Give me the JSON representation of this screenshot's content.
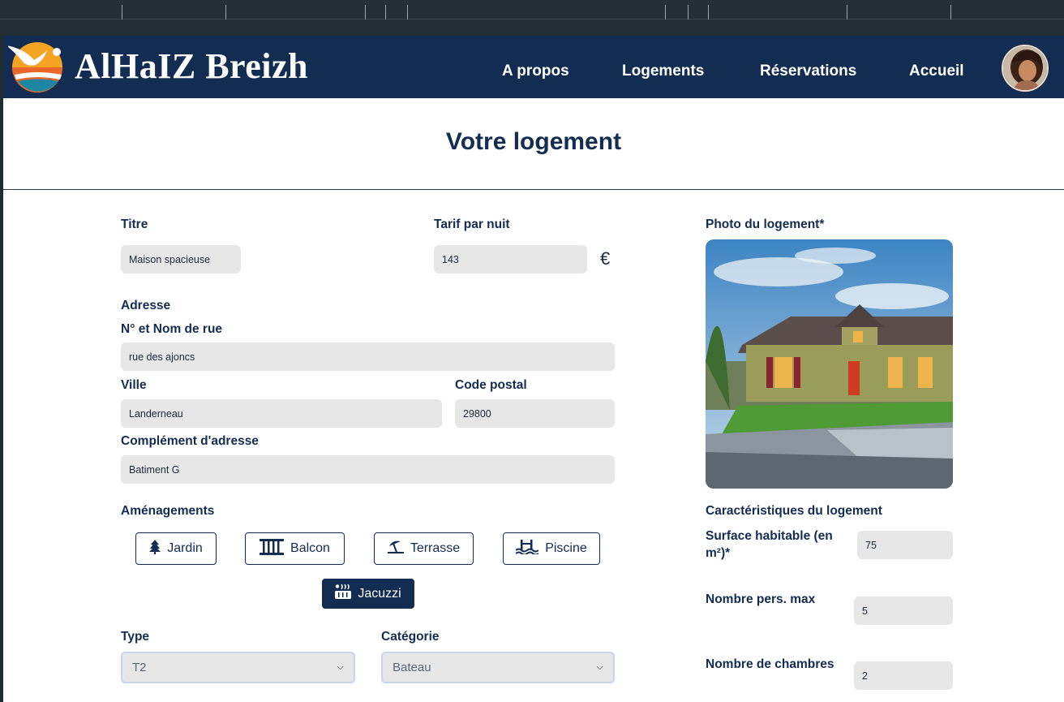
{
  "brand": {
    "name": "AlHaIZ Breizh"
  },
  "nav": {
    "links": [
      "A propos",
      "Logements",
      "Réservations",
      "Accueil"
    ]
  },
  "page": {
    "title": "Votre logement"
  },
  "form": {
    "titre": {
      "label": "Titre",
      "value": "Maison spacieuse"
    },
    "tarif": {
      "label": "Tarif par nuit",
      "value": "143",
      "currency": "€"
    },
    "adresse": {
      "section": "Adresse",
      "rue_label": "N° et Nom de rue",
      "rue_value": "rue des ajoncs",
      "ville_label": "Ville",
      "ville_value": "Landerneau",
      "cp_label": "Code postal",
      "cp_value": "29800",
      "complement_label": "Complément d'adresse",
      "complement_value": "Batiment G"
    },
    "amenagements": {
      "label": "Aménagements",
      "items": [
        {
          "label": "Jardin",
          "icon": "tree-icon",
          "active": false
        },
        {
          "label": "Balcon",
          "icon": "balcony-icon",
          "active": false
        },
        {
          "label": "Terrasse",
          "icon": "umbrella-beach-icon",
          "active": false
        },
        {
          "label": "Piscine",
          "icon": "pool-icon",
          "active": false
        },
        {
          "label": "Jacuzzi",
          "icon": "hot-tub-icon",
          "active": true
        }
      ]
    },
    "type": {
      "label": "Type",
      "value": "T2"
    },
    "categorie": {
      "label": "Catégorie",
      "value": "Bateau"
    }
  },
  "side": {
    "photo_label": "Photo du logement*",
    "carac_label": "Caractéristiques du logement",
    "surface_label": "Surface habitable (en m²)*",
    "surface_value": "75",
    "pers_label": "Nombre pers. max",
    "pers_value": "5",
    "chambres_label": "Nombre de chambres",
    "chambres_value": "2"
  },
  "colors": {
    "navy": "#132c52",
    "field": "#e7e7e7",
    "white": "#ffffff"
  }
}
